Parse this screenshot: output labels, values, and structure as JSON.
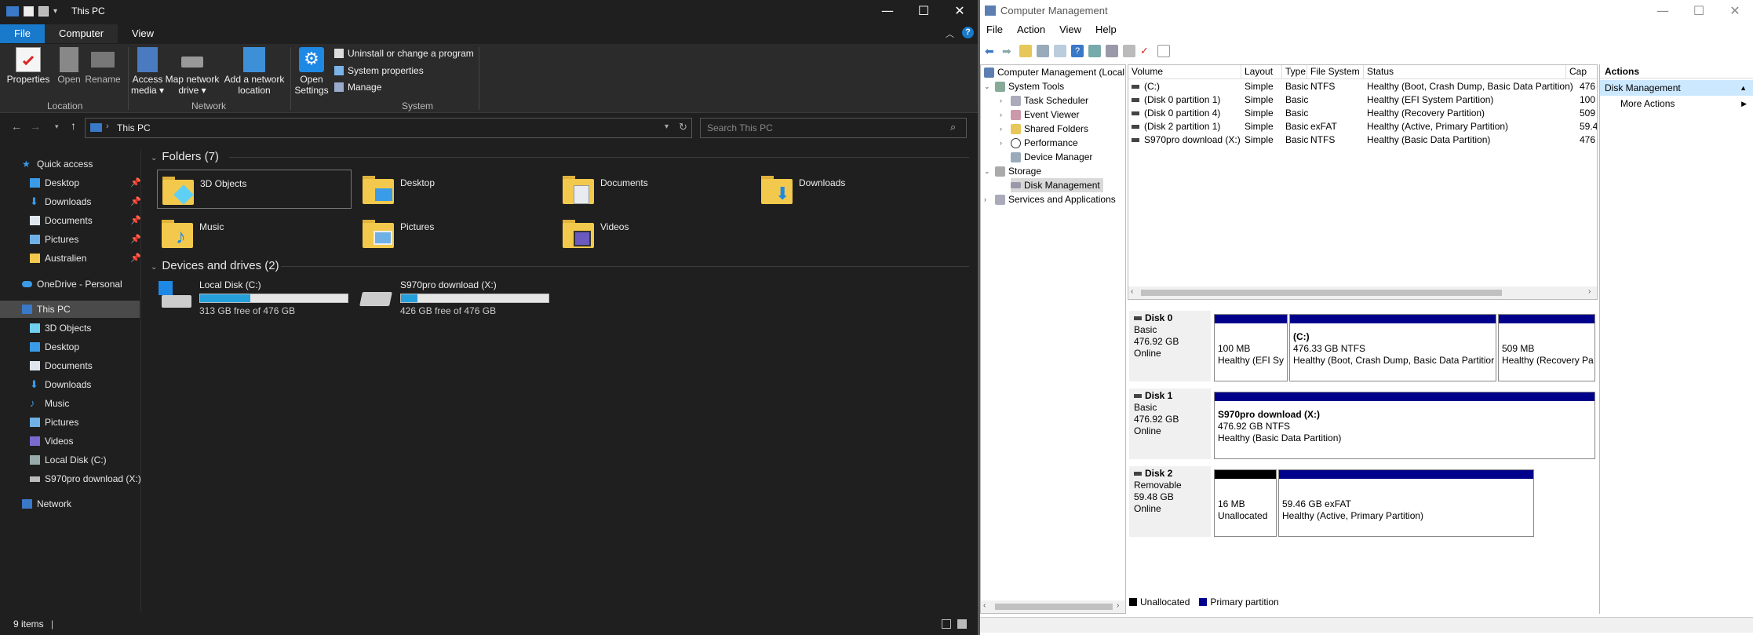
{
  "explorer": {
    "title": "This PC",
    "tabs": [
      "File",
      "Computer",
      "View"
    ],
    "ribbon": {
      "properties": "Properties",
      "open": "Open",
      "rename": "Rename",
      "access_media": "Access media ▾",
      "map_drive": "Map network drive ▾",
      "add_location": "Add a network location",
      "open_settings": "Open Settings",
      "uninstall": "Uninstall or change a program",
      "sys_props": "System properties",
      "manage": "Manage",
      "grp_location": "Location",
      "grp_network": "Network",
      "grp_system": "System"
    },
    "address": "This PC",
    "search_placeholder": "Search This PC",
    "nav": {
      "quick_access": "Quick access",
      "qa_items": [
        "Desktop",
        "Downloads",
        "Documents",
        "Pictures",
        "Australien"
      ],
      "onedrive": "OneDrive - Personal",
      "this_pc": "This PC",
      "pc_items": [
        "3D Objects",
        "Desktop",
        "Documents",
        "Downloads",
        "Music",
        "Pictures",
        "Videos",
        "Local Disk (C:)",
        "S970pro download (X:)"
      ],
      "network": "Network"
    },
    "folders_header": "Folders (7)",
    "folders": [
      "3D Objects",
      "Desktop",
      "Documents",
      "Downloads",
      "Music",
      "Pictures",
      "Videos"
    ],
    "devices_header": "Devices and drives (2)",
    "drives": [
      {
        "name": "Local Disk (C:)",
        "free": "313 GB free of 476 GB",
        "used_fraction": 0.34
      },
      {
        "name": "S970pro download (X:)",
        "free": "426 GB free of 476 GB",
        "used_fraction": 0.11
      }
    ],
    "status": "9 items"
  },
  "cm": {
    "title": "Computer Management",
    "menu": [
      "File",
      "Action",
      "View",
      "Help"
    ],
    "tree": {
      "root": "Computer Management (Local",
      "system_tools": "System Tools",
      "task_scheduler": "Task Scheduler",
      "event_viewer": "Event Viewer",
      "shared_folders": "Shared Folders",
      "performance": "Performance",
      "device_manager": "Device Manager",
      "storage": "Storage",
      "disk_management": "Disk Management",
      "services": "Services and Applications"
    },
    "columns": [
      "Volume",
      "Layout",
      "Type",
      "File System",
      "Status",
      "Cap"
    ],
    "volumes": [
      [
        "(C:)",
        "Simple",
        "Basic",
        "NTFS",
        "Healthy (Boot, Crash Dump, Basic Data Partition)",
        "476"
      ],
      [
        "(Disk 0 partition 1)",
        "Simple",
        "Basic",
        "",
        "Healthy (EFI System Partition)",
        "100"
      ],
      [
        "(Disk 0 partition 4)",
        "Simple",
        "Basic",
        "",
        "Healthy (Recovery Partition)",
        "509"
      ],
      [
        "(Disk 2 partition 1)",
        "Simple",
        "Basic",
        "exFAT",
        "Healthy (Active, Primary Partition)",
        "59.4"
      ],
      [
        "S970pro download (X:)",
        "Simple",
        "Basic",
        "NTFS",
        "Healthy (Basic Data Partition)",
        "476"
      ]
    ],
    "disks": [
      {
        "name": "Disk 0",
        "type": "Basic",
        "size": "476.92 GB",
        "state": "Online",
        "parts": [
          {
            "title": "",
            "size": "100 MB",
            "status": "Healthy (EFI Sy"
          },
          {
            "title": "(C:)",
            "size": "476.33 GB NTFS",
            "status": "Healthy (Boot, Crash Dump, Basic Data Partitior"
          },
          {
            "title": "",
            "size": "509 MB",
            "status": "Healthy (Recovery Pa"
          }
        ]
      },
      {
        "name": "Disk 1",
        "type": "Basic",
        "size": "476.92 GB",
        "state": "Online",
        "parts": [
          {
            "title": "S970pro download  (X:)",
            "size": "476.92 GB NTFS",
            "status": "Healthy (Basic Data Partition)"
          }
        ]
      },
      {
        "name": "Disk 2",
        "type": "Removable",
        "size": "59.48 GB",
        "state": "Online",
        "parts": [
          {
            "title": "",
            "size": "16 MB",
            "status": "Unallocated"
          },
          {
            "title": "",
            "size": "59.46 GB exFAT",
            "status": "Healthy (Active, Primary Partition)"
          }
        ]
      }
    ],
    "legend": [
      "Unallocated",
      "Primary partition"
    ],
    "actions_header": "Actions",
    "actions_section": "Disk Management",
    "more_actions": "More Actions",
    "colors": {
      "primary": "#00008b",
      "unallocated": "#000000",
      "selected": "#cce8ff"
    }
  }
}
